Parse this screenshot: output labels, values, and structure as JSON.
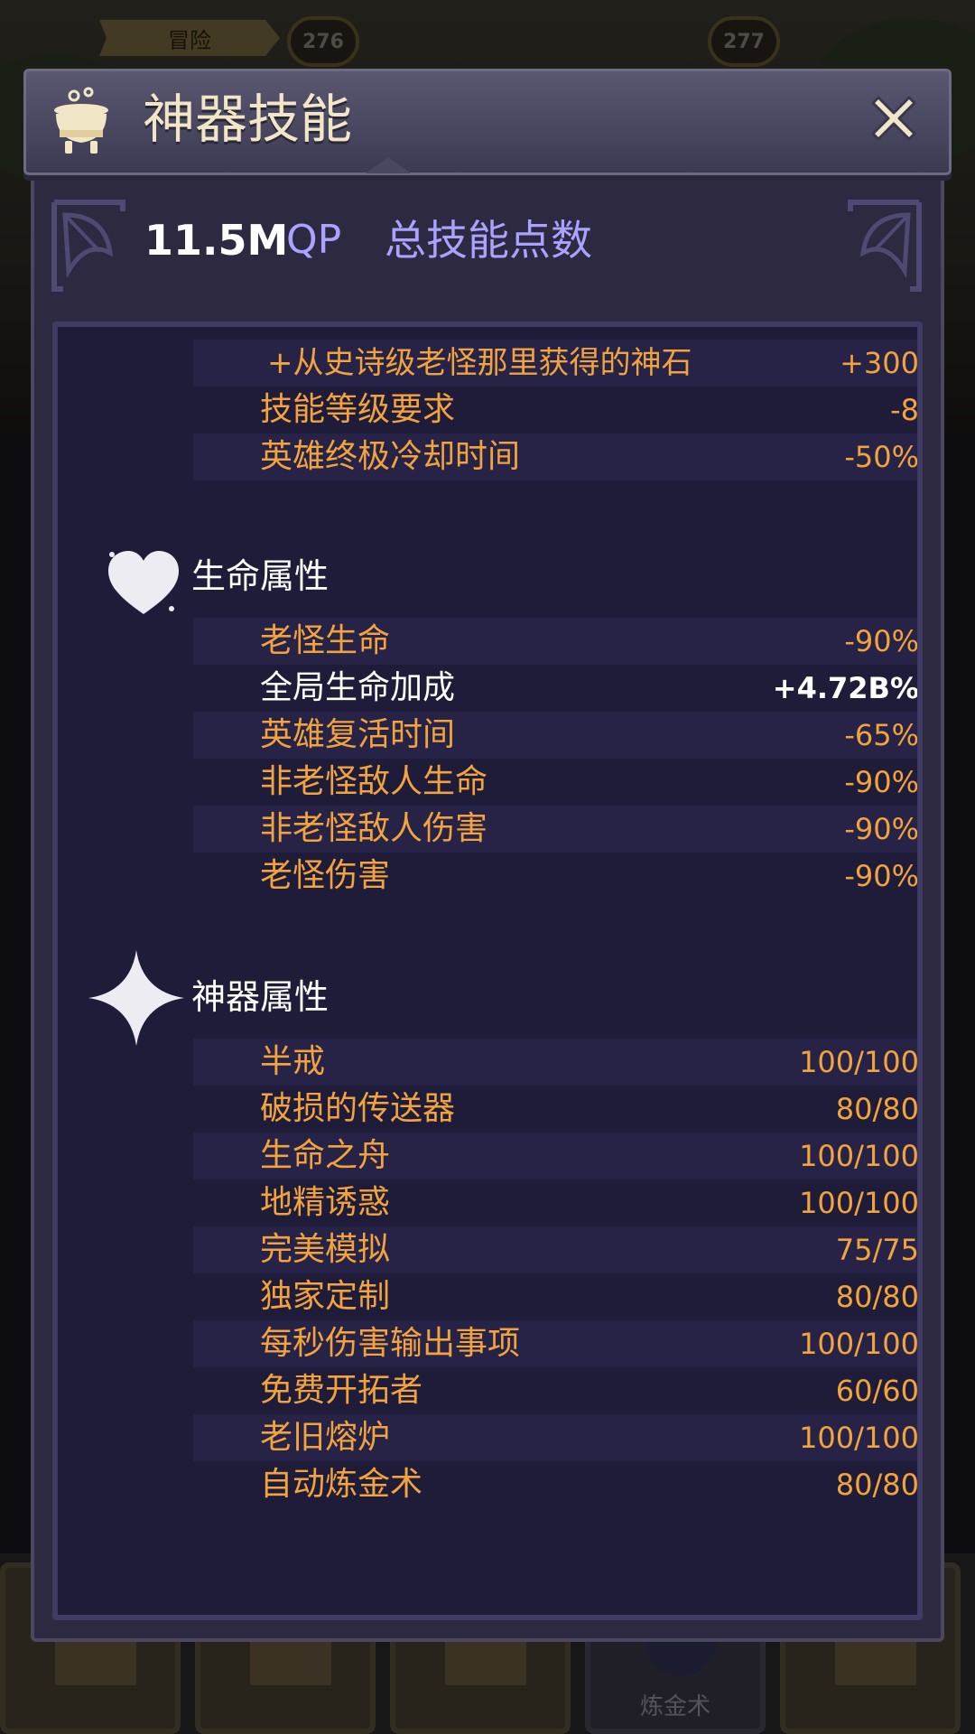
{
  "background": {
    "adventure_tag": "冒险",
    "level_current": "276",
    "level_next": "277",
    "bottom_tab_label": "炼金术"
  },
  "modal": {
    "title": "神器技能",
    "title_icon": "cauldron-icon",
    "close_icon": "close-icon",
    "qp_value": "11.5M",
    "qp_unit": "QP",
    "qp_label": "总技能点数"
  },
  "top_stats": [
    {
      "label": "+从史诗级老怪那里获得的神石",
      "value": "+300"
    },
    {
      "label": "技能等级要求",
      "value": "-8"
    },
    {
      "label": "英雄终极冷却时间",
      "value": "-50%"
    }
  ],
  "life_section": {
    "title": "生命属性",
    "icon": "heart-icon",
    "stats": [
      {
        "label": "老怪生命",
        "value": "-90%"
      },
      {
        "label": "全局生命加成",
        "value": "+4.72B%"
      },
      {
        "label": "英雄复活时间",
        "value": "-65%"
      },
      {
        "label": "非老怪敌人生命",
        "value": "-90%"
      },
      {
        "label": "非老怪敌人伤害",
        "value": "-90%"
      },
      {
        "label": "老怪伤害",
        "value": "-90%"
      }
    ]
  },
  "artifact_section": {
    "title": "神器属性",
    "icon": "sparkle-icon",
    "stats": [
      {
        "label": "半戒",
        "value": "100/100"
      },
      {
        "label": "破损的传送器",
        "value": "80/80"
      },
      {
        "label": "生命之舟",
        "value": "100/100"
      },
      {
        "label": "地精诱惑",
        "value": "100/100"
      },
      {
        "label": "完美模拟",
        "value": "75/75"
      },
      {
        "label": "独家定制",
        "value": "80/80"
      },
      {
        "label": "每秒伤害输出事项",
        "value": "100/100"
      },
      {
        "label": "免费开拓者",
        "value": "60/60"
      },
      {
        "label": "老旧熔炉",
        "value": "100/100"
      },
      {
        "label": "自动炼金术",
        "value": "80/80"
      }
    ]
  },
  "colors": {
    "accent_orange": "#f0a33e",
    "qp_purple": "#a9a3ff",
    "panel_bg": "#1f1c3a"
  }
}
